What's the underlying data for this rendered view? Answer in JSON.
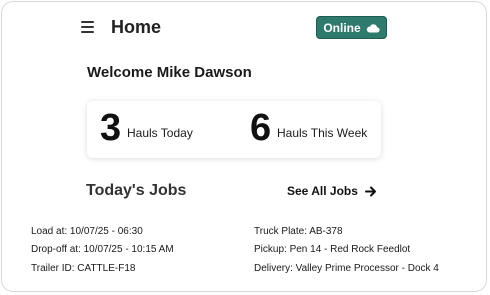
{
  "header": {
    "title": "Home",
    "menu_icon": "hamburger-menu-icon",
    "status_badge": {
      "label": "Online",
      "icon": "cloud-icon",
      "color": "#2e7b6e"
    }
  },
  "welcome_text": "Welcome Mike Dawson",
  "stats": {
    "today": {
      "value": "3",
      "label": "Hauls Today"
    },
    "week": {
      "value": "6",
      "label": "Hauls This Week"
    }
  },
  "jobs": {
    "heading": "Today's Jobs",
    "see_all_label": "See All Jobs",
    "see_all_icon": "arrow-right-icon",
    "details": {
      "load_at": "Load at: 10/07/25 - 06:30",
      "drop_off_at": "Drop-off at: 10/07/25 - 10:15 AM",
      "trailer_id": "Trailer ID: CATTLE-F18",
      "truck_plate": "Truck Plate: AB-378",
      "pickup": "Pickup: Pen 14 - Red Rock Feedlot",
      "delivery": "Delivery: Valley Prime Processor - Dock 4"
    }
  }
}
